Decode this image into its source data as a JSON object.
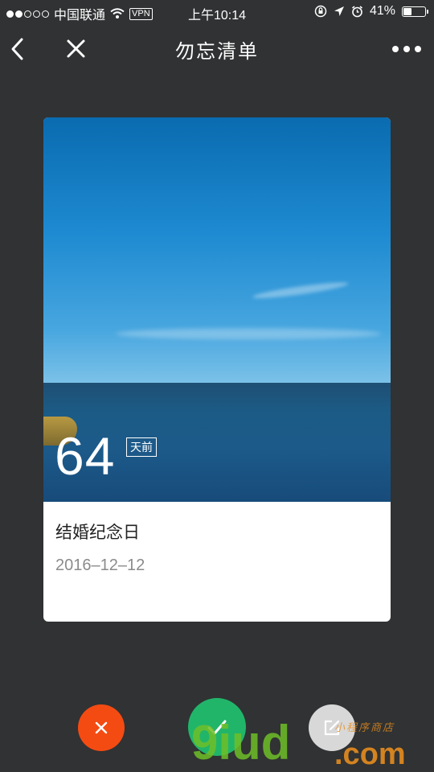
{
  "status_bar": {
    "carrier": "中国联通",
    "vpn": "VPN",
    "time": "上午10:14",
    "battery": "41%",
    "battery_level": 0.41,
    "signal_bars": 2
  },
  "nav": {
    "title": "勿忘清单"
  },
  "card": {
    "days": "64",
    "days_unit": "天前",
    "event_name": "结婚纪念日",
    "event_date": "2016–12–12"
  },
  "watermark": {
    "main": "9iud",
    "com": ".com",
    "small": "小程序商店"
  },
  "colors": {
    "background": "#303233",
    "cancel": "#f44b13",
    "done": "#21b56a",
    "edit": "#d8d8d8"
  },
  "icons": {
    "back": "chevron-left-icon",
    "close": "close-icon",
    "more": "more-icon",
    "cancel": "close-icon",
    "done": "check-icon",
    "edit": "edit-icon"
  }
}
